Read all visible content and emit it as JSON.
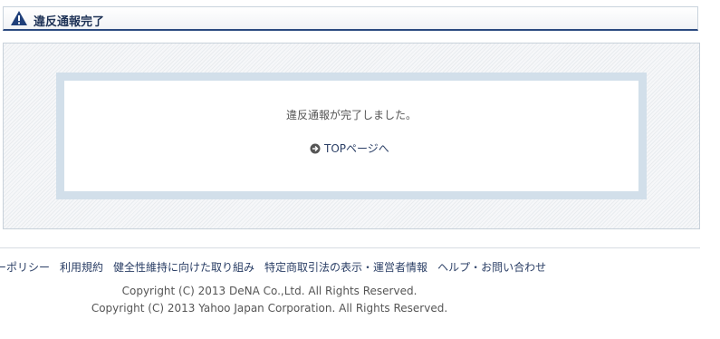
{
  "header": {
    "title": "違反通報完了",
    "icon": "warning-icon"
  },
  "message": {
    "text": "違反通報が完了しました。",
    "top_link_label": "TOPページへ",
    "top_link_icon": "arrow-right-circle-icon"
  },
  "footer": {
    "links": [
      {
        "label": "ーポリシー"
      },
      {
        "label": "利用規約"
      },
      {
        "label": "健全性維持に向けた取り組み"
      },
      {
        "label": "特定商取引法の表示・運営者情報"
      },
      {
        "label": "ヘルプ・お問い合わせ"
      }
    ],
    "copyright_1": "Copyright (C) 2013 DeNA Co.,Ltd. All Rights Reserved.",
    "copyright_2": "Copyright (C) 2013 Yahoo Japan Corporation. All Rights Reserved."
  },
  "colors": {
    "header_text": "#1f3357",
    "header_rule": "#2b4a80",
    "link": "#2b3f66",
    "message_frame": "#d2dfea"
  }
}
